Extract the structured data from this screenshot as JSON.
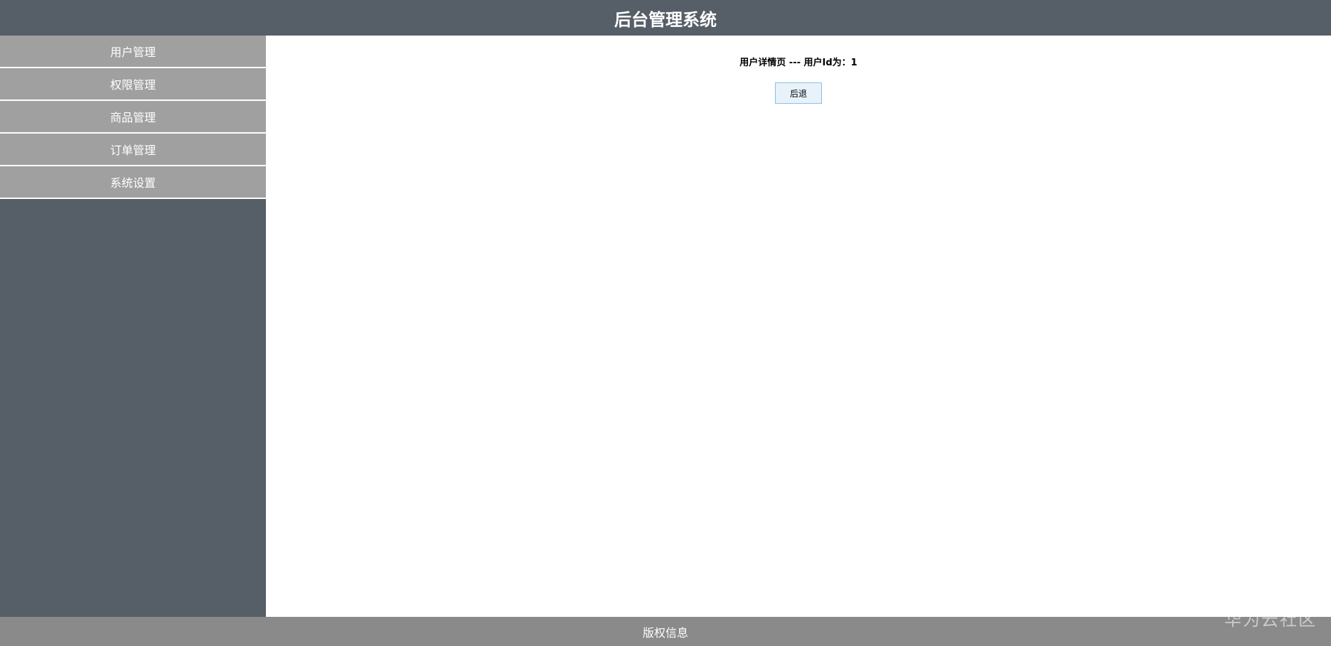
{
  "header": {
    "title": "后台管理系统"
  },
  "sidebar": {
    "items": [
      {
        "label": "用户管理"
      },
      {
        "label": "权限管理"
      },
      {
        "label": "商品管理"
      },
      {
        "label": "订单管理"
      },
      {
        "label": "系统设置"
      }
    ]
  },
  "main": {
    "detail_title": "用户详情页 --- 用户Id为：1",
    "back_button_label": "后退"
  },
  "footer": {
    "text": "版权信息"
  },
  "watermark": {
    "text": "华为云社区"
  },
  "colors": {
    "header_bg": "#565e67",
    "sidebar_item_bg": "#a0a0a0",
    "footer_bg": "#8a8a8a",
    "button_bg": "#e8f2fa",
    "button_border": "#8cbfe0"
  }
}
